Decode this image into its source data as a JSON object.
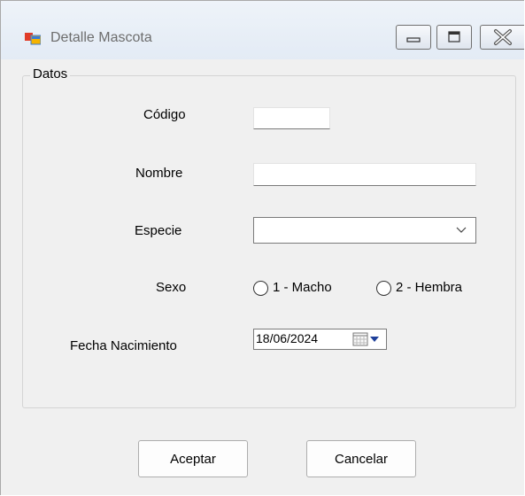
{
  "window": {
    "title": "Detalle Mascota"
  },
  "group": {
    "title": "Datos"
  },
  "fields": {
    "codigo_label": "Código",
    "codigo_value": "",
    "nombre_label": "Nombre",
    "nombre_value": "",
    "especie_label": "Especie",
    "especie_value": "",
    "sexo_label": "Sexo",
    "sexo_options": [
      "1 - Macho",
      "2 - Hembra"
    ],
    "fecha_label": "Fecha Nacimiento",
    "fecha_value": "18/06/2024"
  },
  "buttons": {
    "accept": "Aceptar",
    "cancel": "Cancelar"
  },
  "icons": {
    "app": "app-window-icon",
    "minimize": "minimize-icon",
    "maximize": "maximize-icon",
    "close": "close-icon",
    "dropdown": "chevron-down-icon",
    "calendar": "calendar-icon"
  },
  "colors": {
    "window_bg": "#f0f0f0",
    "titlebar_text": "#6d6d6d",
    "input_border": "#7a7a7a"
  }
}
